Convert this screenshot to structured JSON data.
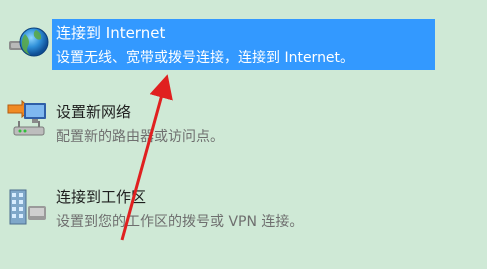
{
  "options": [
    {
      "title": "连接到 Internet",
      "desc": "设置无线、宽带或拨号连接，连接到 Internet。",
      "icon": "globe-network-icon",
      "selected": true
    },
    {
      "title": "设置新网络",
      "desc": "配置新的路由器或访问点。",
      "icon": "router-setup-icon",
      "selected": false
    },
    {
      "title": "连接到工作区",
      "desc": "设置到您的工作区的拨号或 VPN 连接。",
      "icon": "workplace-building-icon",
      "selected": false
    }
  ],
  "colors": {
    "background": "#cfe9d6",
    "selection": "#3399ff",
    "annotation_arrow": "#e02020"
  }
}
